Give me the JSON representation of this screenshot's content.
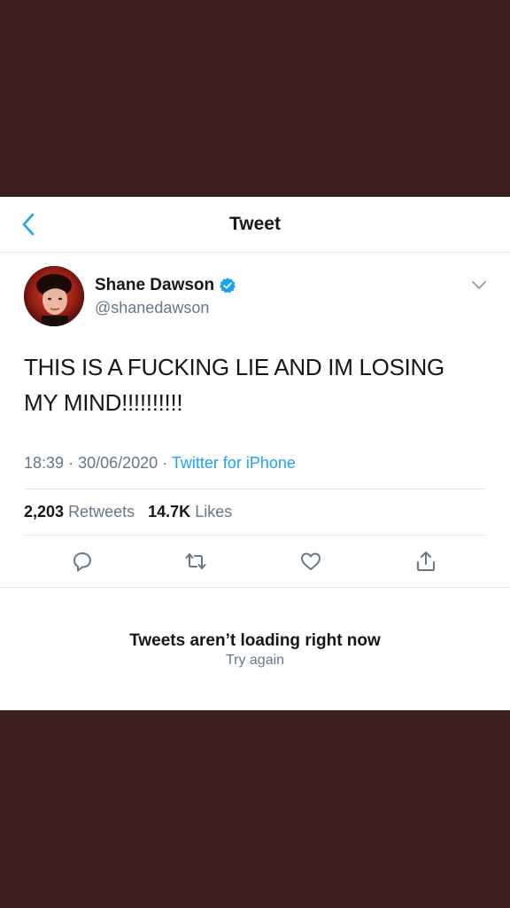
{
  "header": {
    "title": "Tweet",
    "back_icon": "chevron-left-icon"
  },
  "tweet": {
    "display_name": "Shane Dawson",
    "handle": "@shanedawson",
    "verified": true,
    "text_line1": "THIS IS A FUCKING LIE AND IM LOSING",
    "text_line2": "MY MIND!!!!!!!!!!",
    "time": "18:39",
    "date": "30/06/2020",
    "separator": "·",
    "source": "Twitter for iPhone",
    "retweets_count": "2,203",
    "retweets_label": "Retweets",
    "likes_count": "14.7K",
    "likes_label": "Likes"
  },
  "actions": [
    "reply-icon",
    "retweet-icon",
    "like-icon",
    "share-icon"
  ],
  "error": {
    "title": "Tweets aren’t loading right now",
    "retry": "Try again"
  },
  "colors": {
    "accent": "#1da1f2",
    "text": "#14171a",
    "secondary": "#657786",
    "frame": "#3a1f1c"
  }
}
